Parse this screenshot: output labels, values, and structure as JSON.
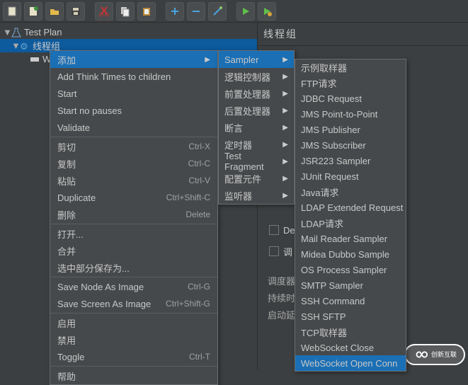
{
  "toolbar_icons": [
    "file-new",
    "file-wizard",
    "file-open",
    "file-save",
    "cut",
    "copy",
    "paste",
    "plus",
    "minus",
    "wand",
    "run",
    "run-mark"
  ],
  "tree": {
    "root": "Test Plan",
    "thread_group": "线程组",
    "ws_prefix": "W"
  },
  "right_panel_title": "线程组",
  "ctx": {
    "add": "添加",
    "add_think": "Add Think Times to children",
    "start": "Start",
    "start_no_pauses": "Start no pauses",
    "validate": "Validate",
    "cut": "剪切",
    "cut_sc": "Ctrl-X",
    "copy": "复制",
    "copy_sc": "Ctrl-C",
    "paste": "粘贴",
    "paste_sc": "Ctrl-V",
    "duplicate": "Duplicate",
    "duplicate_sc": "Ctrl+Shift-C",
    "delete": "删除",
    "delete_sc": "Delete",
    "open": "打开...",
    "merge": "合并",
    "save_sel": "选中部分保存为...",
    "save_node_img": "Save Node As Image",
    "save_node_img_sc": "Ctrl-G",
    "save_screen_img": "Save Screen As Image",
    "save_screen_img_sc": "Ctrl+Shift-G",
    "enable": "启用",
    "disable": "禁用",
    "toggle": "Toggle",
    "toggle_sc": "Ctrl-T",
    "help": "帮助"
  },
  "sub1": {
    "sampler": "Sampler",
    "logic": "逻辑控制器",
    "pre": "前置处理器",
    "post": "后置处理器",
    "assert": "断言",
    "timer": "定时器",
    "testfrag": "Test Fragment",
    "config": "配置元件",
    "listener": "监听器"
  },
  "sub2": {
    "i0": "示例取样器",
    "i1": "FTP请求",
    "i2": "JDBC Request",
    "i3": "JMS Point-to-Point",
    "i4": "JMS Publisher",
    "i5": "JMS Subscriber",
    "i6": "JSR223 Sampler",
    "i7": "JUnit Request",
    "i8": "Java请求",
    "i9": "LDAP Extended Request",
    "i10": "LDAP请求",
    "i11": "Mail Reader Sampler",
    "i12": "Midea Dubbo Sample",
    "i13": "OS Process Sampler",
    "i14": "SMTP Sampler",
    "i15": "SSH Command",
    "i16": "SSH SFTP",
    "i17": "TCP取样器",
    "i18": "WebSocket Close",
    "i19": "WebSocket Open Conn"
  },
  "bg": {
    "de": "De",
    "tiao": "调",
    "sched": "调度器",
    "dur": "持续时",
    "delay": "启动延"
  },
  "watermark": "创新互联"
}
